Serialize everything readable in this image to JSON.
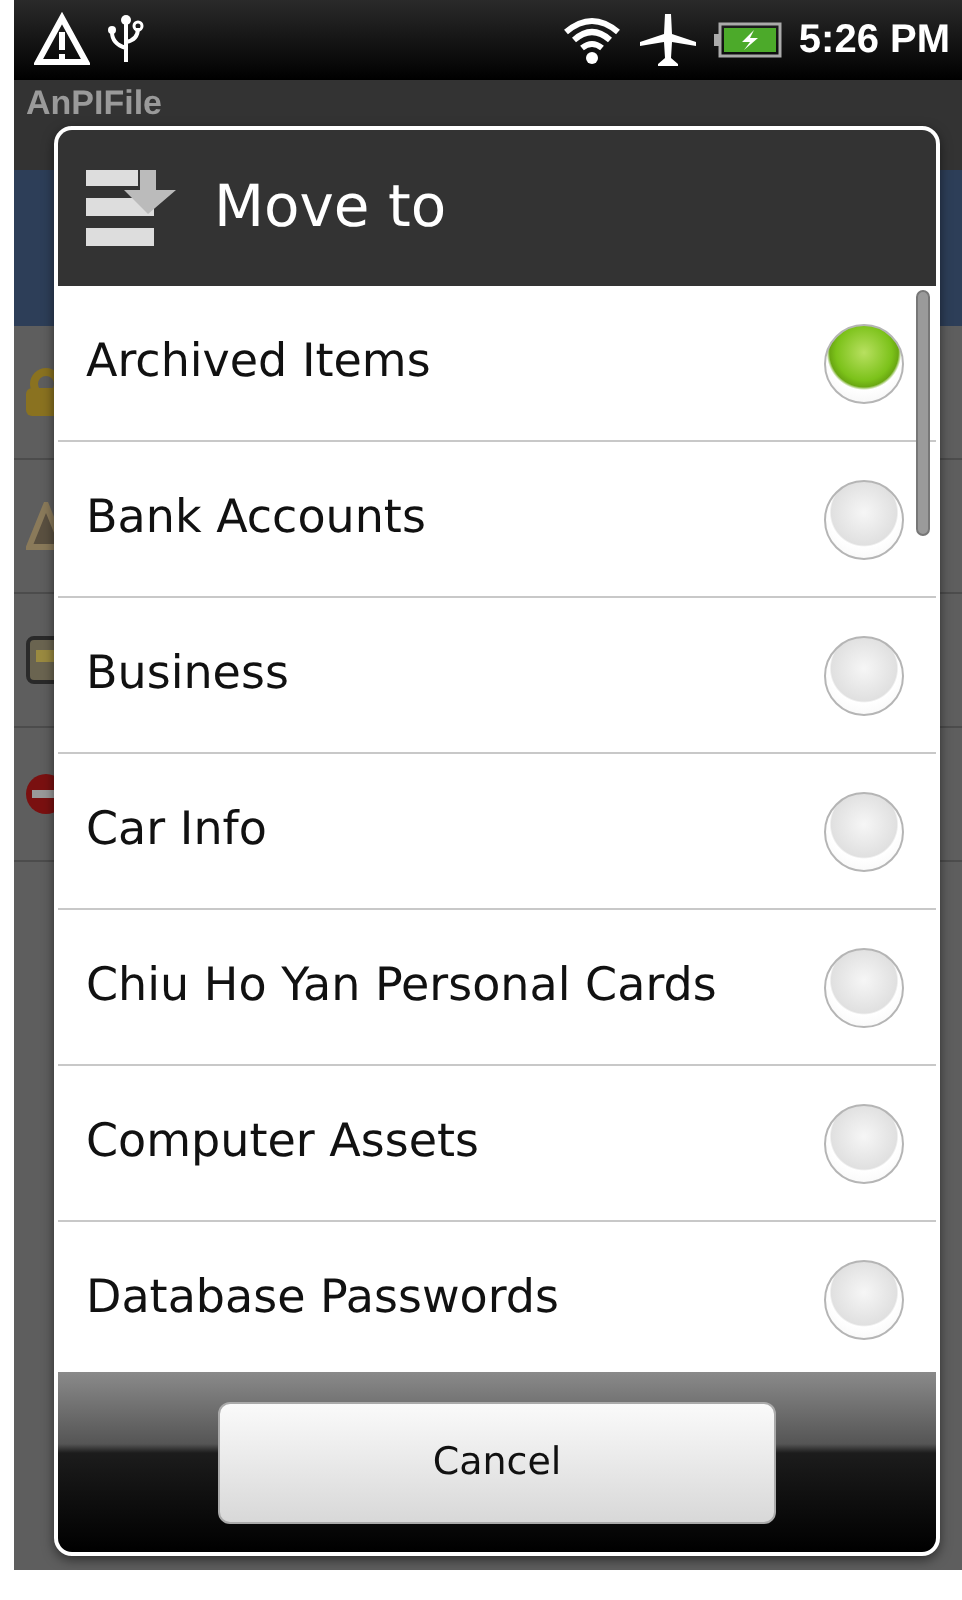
{
  "status_bar": {
    "time": "5:26 PM"
  },
  "app": {
    "title": "AnPIFile"
  },
  "dialog": {
    "title": "Move to",
    "options": [
      {
        "label": "Archived Items",
        "selected": true
      },
      {
        "label": "Bank Accounts",
        "selected": false
      },
      {
        "label": "Business",
        "selected": false
      },
      {
        "label": "Car Info",
        "selected": false
      },
      {
        "label": "Chiu Ho Yan Personal Cards",
        "selected": false
      },
      {
        "label": "Computer Assets",
        "selected": false
      },
      {
        "label": "Database Passwords",
        "selected": false
      }
    ],
    "buttons": [
      "Cancel"
    ]
  }
}
